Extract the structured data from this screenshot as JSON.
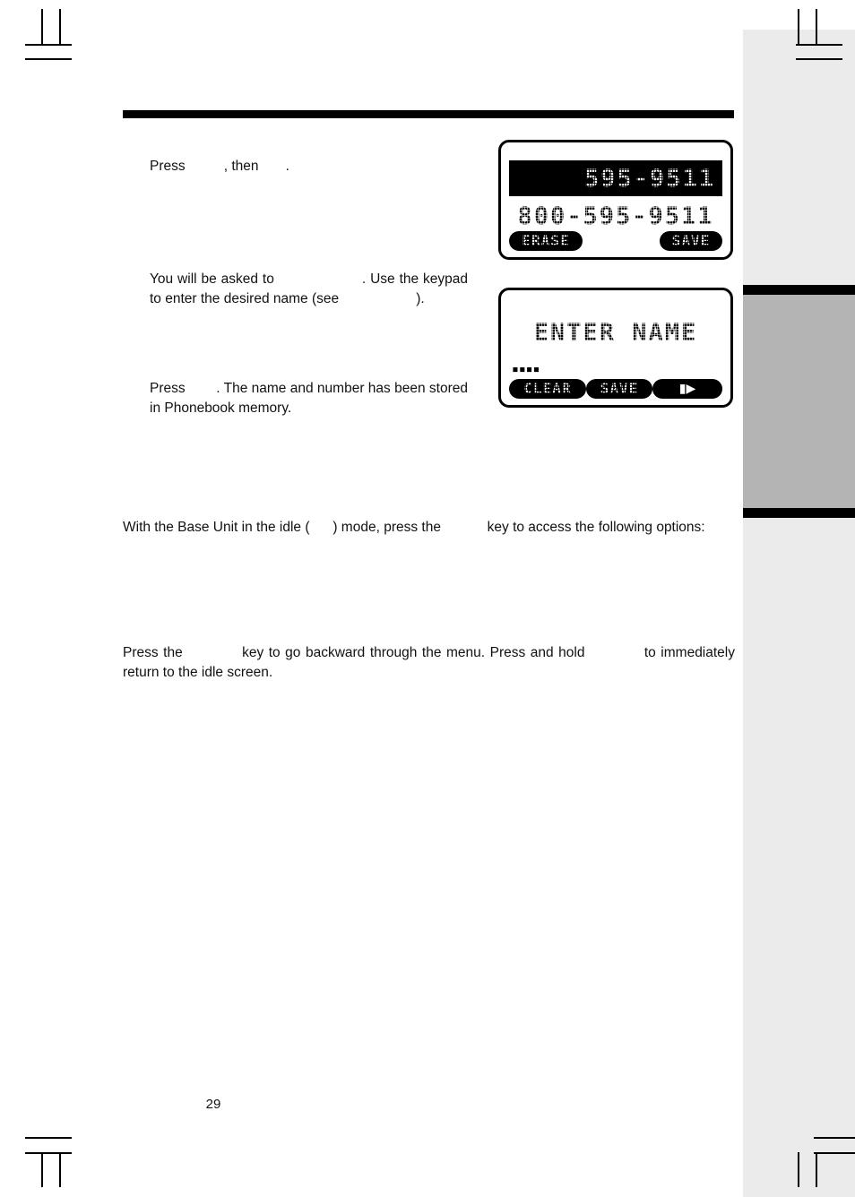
{
  "page": {
    "number": "29",
    "page_number_display": "29"
  },
  "body": {
    "paragraph_press_save": {
      "before": "Press",
      "gap_1": "          ",
      "middle": ", then",
      "gap_2": "       ",
      "after": "."
    },
    "paragraph_enter_name": {
      "line1_before": "You  will  be  asked  to",
      "gap_1": "                    ",
      "line1_after": ".  Use  the",
      "line2": "keypad to enter the desired name (see",
      "gap_2": "                    ",
      "line3_after": ")."
    },
    "paragraph_stored": {
      "before": "Press",
      "gap_1": "        ",
      "after": ".  The  name  and  number  has  been stored  in  Phonebook  memory."
    },
    "paragraph_idle_mode": {
      "before": "With  the  Base  Unit  in  the  idle  (",
      "gap_1": "      ",
      "middle": ")  mode,  press  the",
      "gap_2": "            ",
      "after": "key  to  access  the  following options:"
    },
    "paragraph_backward": {
      "before": "Press the",
      "gap_1": "            ",
      "middle": "key to go backward through the menu. Press and hold",
      "gap_2": "            ",
      "after": "to immediately return to the idle screen."
    }
  },
  "lcd_screens": [
    {
      "id": "caller-id-review",
      "line_highlighted": "595-9511",
      "line_plain": "800-595-9511",
      "softkeys": [
        {
          "label": "ERASE",
          "name": "erase"
        },
        {
          "label": "SAVE",
          "name": "save"
        }
      ]
    },
    {
      "id": "enter-name",
      "title": "ENTER NAME",
      "cursor_marker": "▪▪▪▪",
      "softkeys": [
        {
          "label": "CLEAR",
          "name": "clear"
        },
        {
          "label": "SAVE",
          "name": "save"
        },
        {
          "label": "",
          "name": "next-arrow",
          "glyph": "▮▶"
        }
      ]
    }
  ],
  "colors": {
    "page_background": "#ffffff",
    "text": "#111111",
    "rule": "#000000",
    "margin_strip": "#ebebeb",
    "margin_tab_block": "#b4b4b4",
    "lcd_border": "#000000",
    "lcd_invert_background": "#000000",
    "lcd_invert_text": "#ffffff"
  }
}
